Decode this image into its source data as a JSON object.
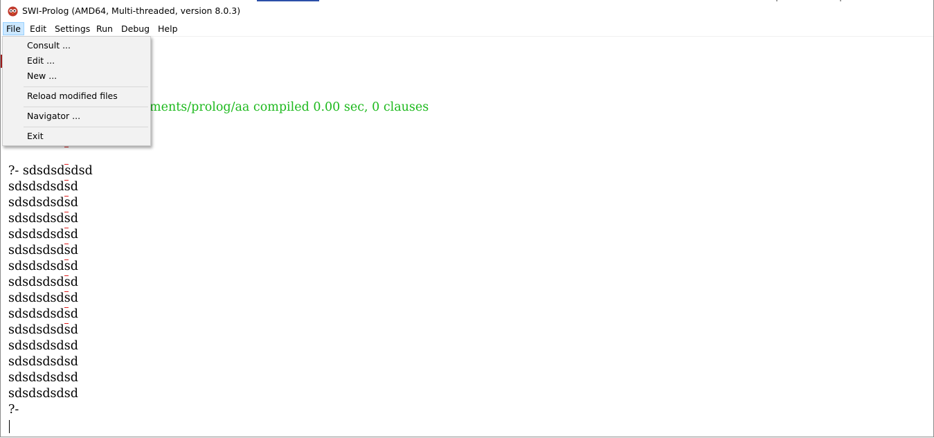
{
  "window": {
    "title": "SWI-Prolog (AMD64, Multi-threaded, version 8.0.3)"
  },
  "menubar": {
    "items": [
      "File",
      "Edit",
      "Settings",
      "Run",
      "Debug",
      "Help"
    ],
    "active": "File"
  },
  "file_menu": {
    "items": [
      {
        "label": "Consult ..."
      },
      {
        "label": "Edit ..."
      },
      {
        "label": "New ..."
      },
      {
        "label": "Reload modified files"
      },
      {
        "label": "Navigator ..."
      },
      {
        "label": "Exit"
      }
    ]
  },
  "console": {
    "compiled_message": "ments/prolog/aa compiled 0.00 sec, 0 clauses",
    "query_line": "?- sdsdsdsdsd",
    "output_line": "sdsdsdsdsd",
    "output_count": 14,
    "prompt": "?-"
  },
  "colors": {
    "compiled_text": "#1db91d",
    "menu_highlight": "#cce8ff",
    "menu_background": "#f2f2f2"
  },
  "icons": {
    "app": "swi-prolog-owl-icon"
  }
}
